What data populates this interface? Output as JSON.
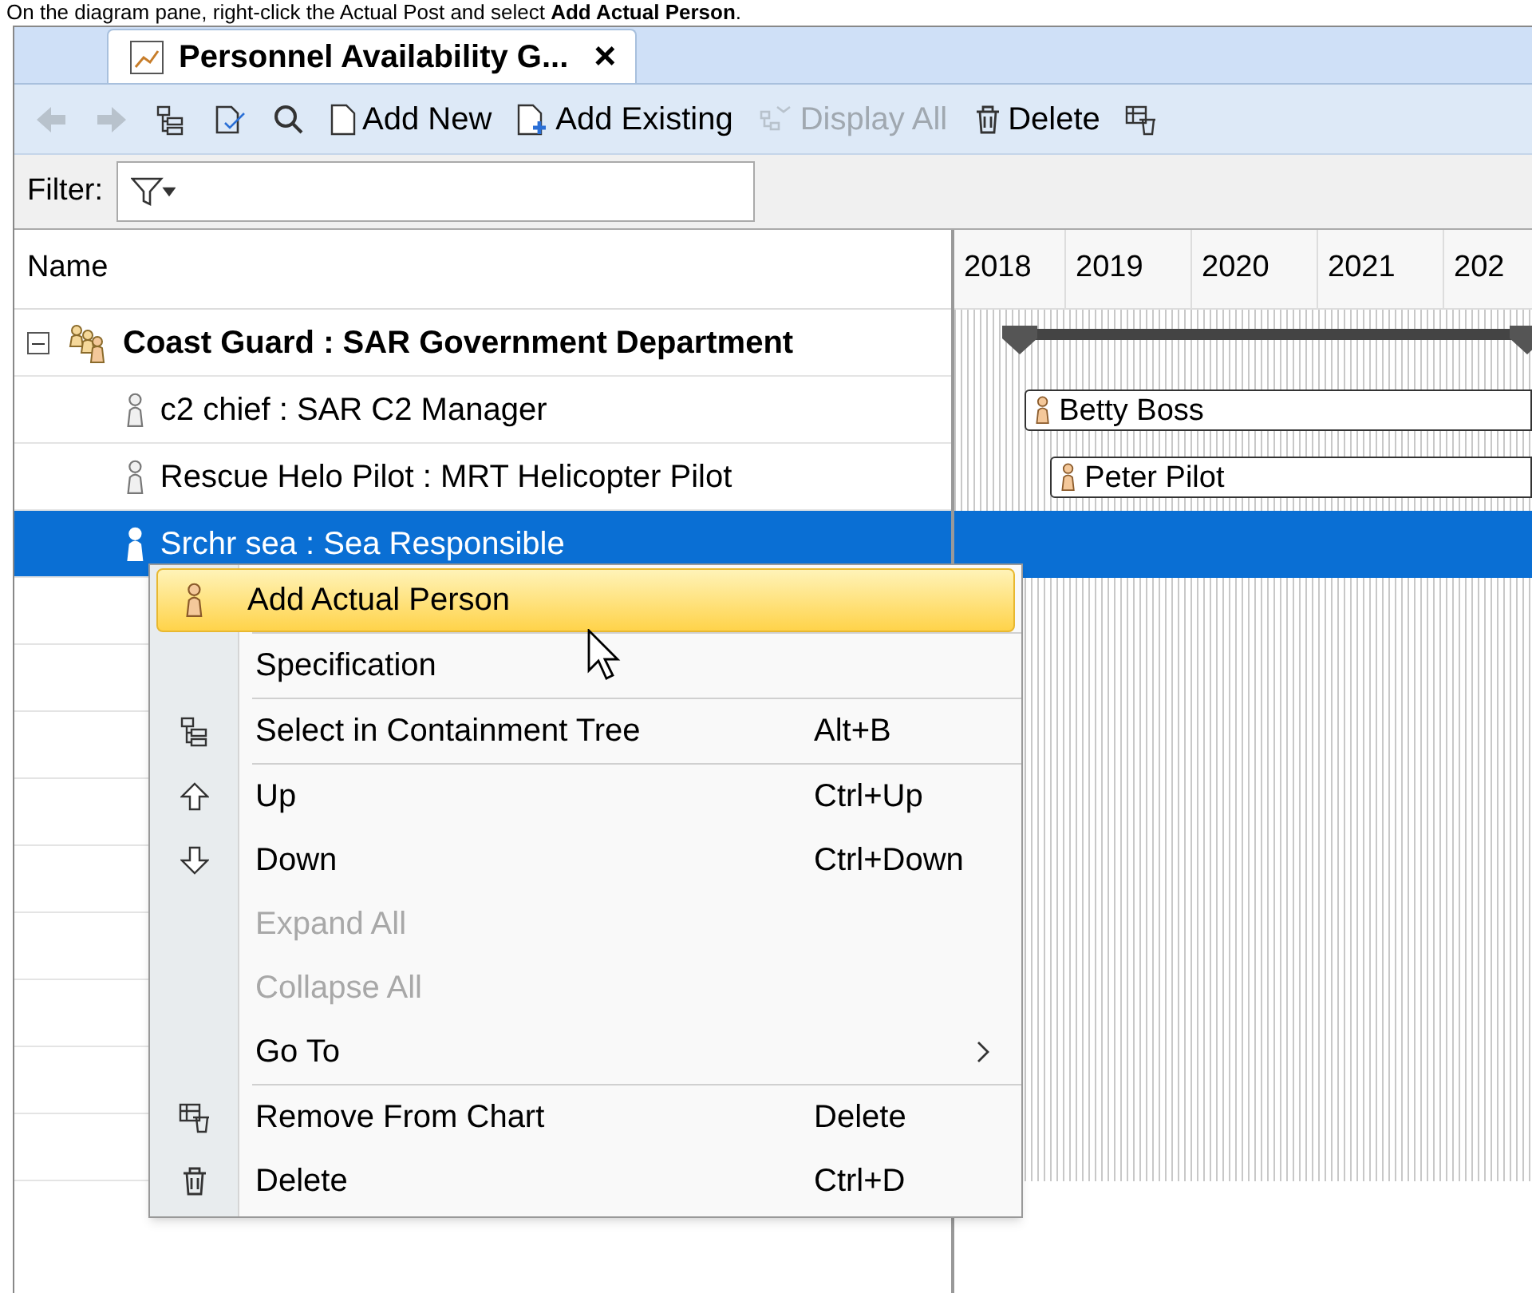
{
  "instruction": "On the diagram pane, right-click the Actual Post and select **Add Actual Person**.",
  "tab": {
    "title": "Personnel Availability G...",
    "close": "×",
    "selected": true
  },
  "toolbar": [
    {
      "disabled": true
    },
    {
      "disabled": true
    },
    {
      "disabled": false
    },
    {
      "disabled": false
    },
    {
      "disabled": false
    },
    {
      "label": "Add New",
      "disabled": false
    },
    {
      "label": "Add Existing",
      "disabled": false
    },
    {
      "label": "Display All",
      "disabled": true
    },
    {
      "label": "Delete",
      "disabled": false
    },
    {
      "disabled": false
    }
  ],
  "filter": {
    "label": "Filter:"
  },
  "table": {
    "column": "Name",
    "years": [
      "2018",
      "2019",
      "2020",
      "2021",
      "202"
    ],
    "rows": [
      {
        "label": "Coast Guard : SAR Government Department",
        "kind": "group",
        "expanded": true,
        "selected": false,
        "bar": {
          "kind": "summary"
        },
        "children": [
          {
            "label": "c2 chief : SAR C2 Manager",
            "kind": "post",
            "selected": false,
            "bar": {
              "kind": "task",
              "label": "Betty Boss"
            }
          },
          {
            "label": "Rescue Helo Pilot : MRT Helicopter Pilot",
            "kind": "post",
            "selected": false,
            "bar": {
              "kind": "task",
              "label": "Peter Pilot"
            }
          },
          {
            "label": "Srchr sea : Sea Responsible",
            "kind": "post",
            "selected": true
          }
        ]
      }
    ]
  },
  "menu": {
    "groups": [
      [
        {
          "label": "Add Actual Person",
          "selected": true,
          "disabled": false
        }
      ],
      [
        {
          "label": "Specification",
          "selected": false,
          "disabled": false
        }
      ],
      [
        {
          "label": "Select in Containment Tree",
          "shortcut": "Alt+B",
          "selected": false,
          "disabled": false
        }
      ],
      [
        {
          "label": "Up",
          "shortcut": "Ctrl+Up",
          "selected": false,
          "disabled": false
        },
        {
          "label": "Down",
          "shortcut": "Ctrl+Down",
          "selected": false,
          "disabled": false
        },
        {
          "label": "Expand All",
          "selected": false,
          "disabled": true
        },
        {
          "label": "Collapse All",
          "selected": false,
          "disabled": true
        },
        {
          "label": "Go To",
          "selected": false,
          "disabled": false,
          "submenu": true
        }
      ],
      [
        {
          "label": "Remove From Chart",
          "shortcut": "Delete",
          "selected": false,
          "disabled": false
        },
        {
          "label": "Delete",
          "shortcut": "Ctrl+D",
          "selected": false,
          "disabled": false
        }
      ]
    ]
  }
}
